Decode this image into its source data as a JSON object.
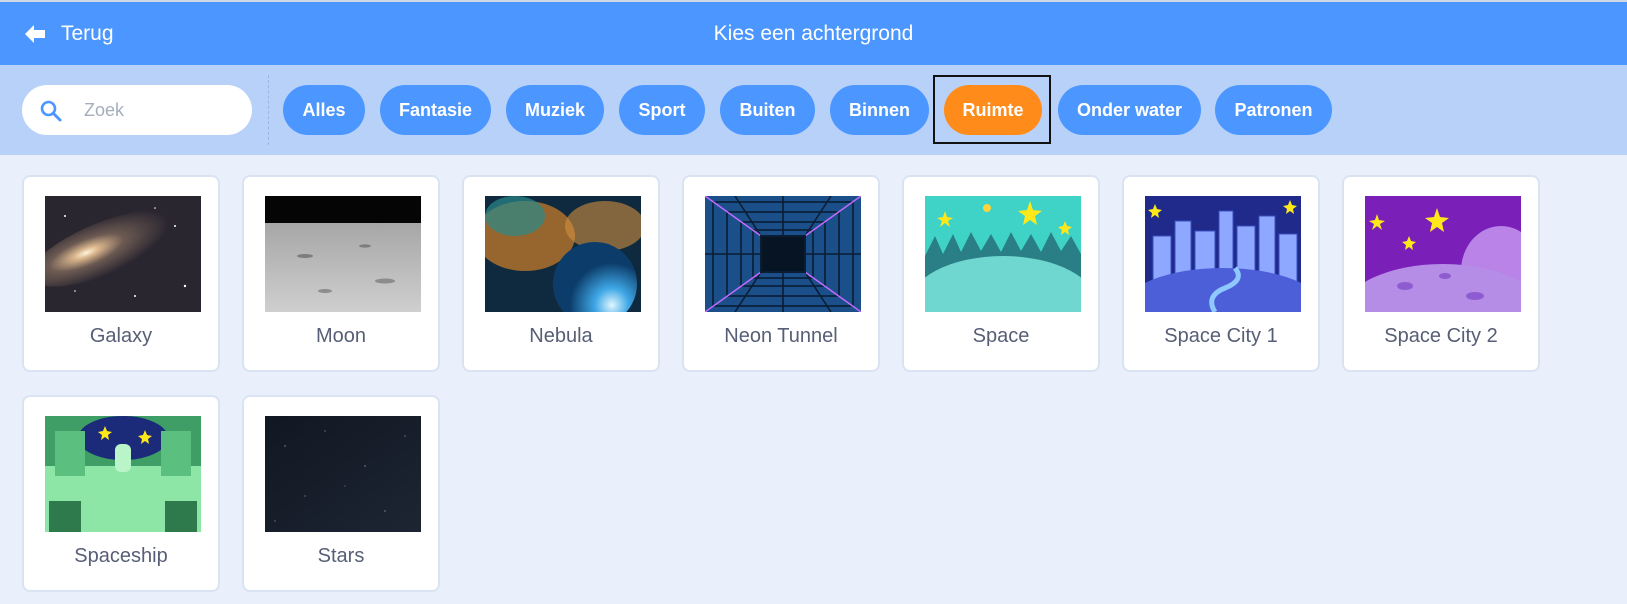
{
  "header": {
    "back_label": "Terug",
    "title": "Kies een achtergrond"
  },
  "search": {
    "placeholder": "Zoek",
    "value": ""
  },
  "tags": [
    {
      "label": "Alles",
      "active": false
    },
    {
      "label": "Fantasie",
      "active": false
    },
    {
      "label": "Muziek",
      "active": false
    },
    {
      "label": "Sport",
      "active": false
    },
    {
      "label": "Buiten",
      "active": false
    },
    {
      "label": "Binnen",
      "active": false
    },
    {
      "label": "Ruimte",
      "active": true
    },
    {
      "label": "Onder water",
      "active": false
    },
    {
      "label": "Patronen",
      "active": false
    }
  ],
  "backdrops": [
    {
      "name": "Galaxy",
      "icon": "galaxy-thumbnail"
    },
    {
      "name": "Moon",
      "icon": "moon-surface-thumbnail"
    },
    {
      "name": "Nebula",
      "icon": "nebula-thumbnail"
    },
    {
      "name": "Neon Tunnel",
      "icon": "neon-tunnel-thumbnail"
    },
    {
      "name": "Space",
      "icon": "space-thumbnail"
    },
    {
      "name": "Space City 1",
      "icon": "space-city-1-thumbnail"
    },
    {
      "name": "Space City 2",
      "icon": "space-city-2-thumbnail"
    },
    {
      "name": "Spaceship",
      "icon": "spaceship-interior-thumbnail"
    },
    {
      "name": "Stars",
      "icon": "stars-thumbnail"
    }
  ],
  "colors": {
    "header_bg": "#4c97ff",
    "filterbar_bg": "#b8d1f9",
    "tag_bg": "#4c97ff",
    "tag_active_bg": "#ff8c1a",
    "page_bg": "#e9f0fb",
    "label_text": "#575e75"
  }
}
